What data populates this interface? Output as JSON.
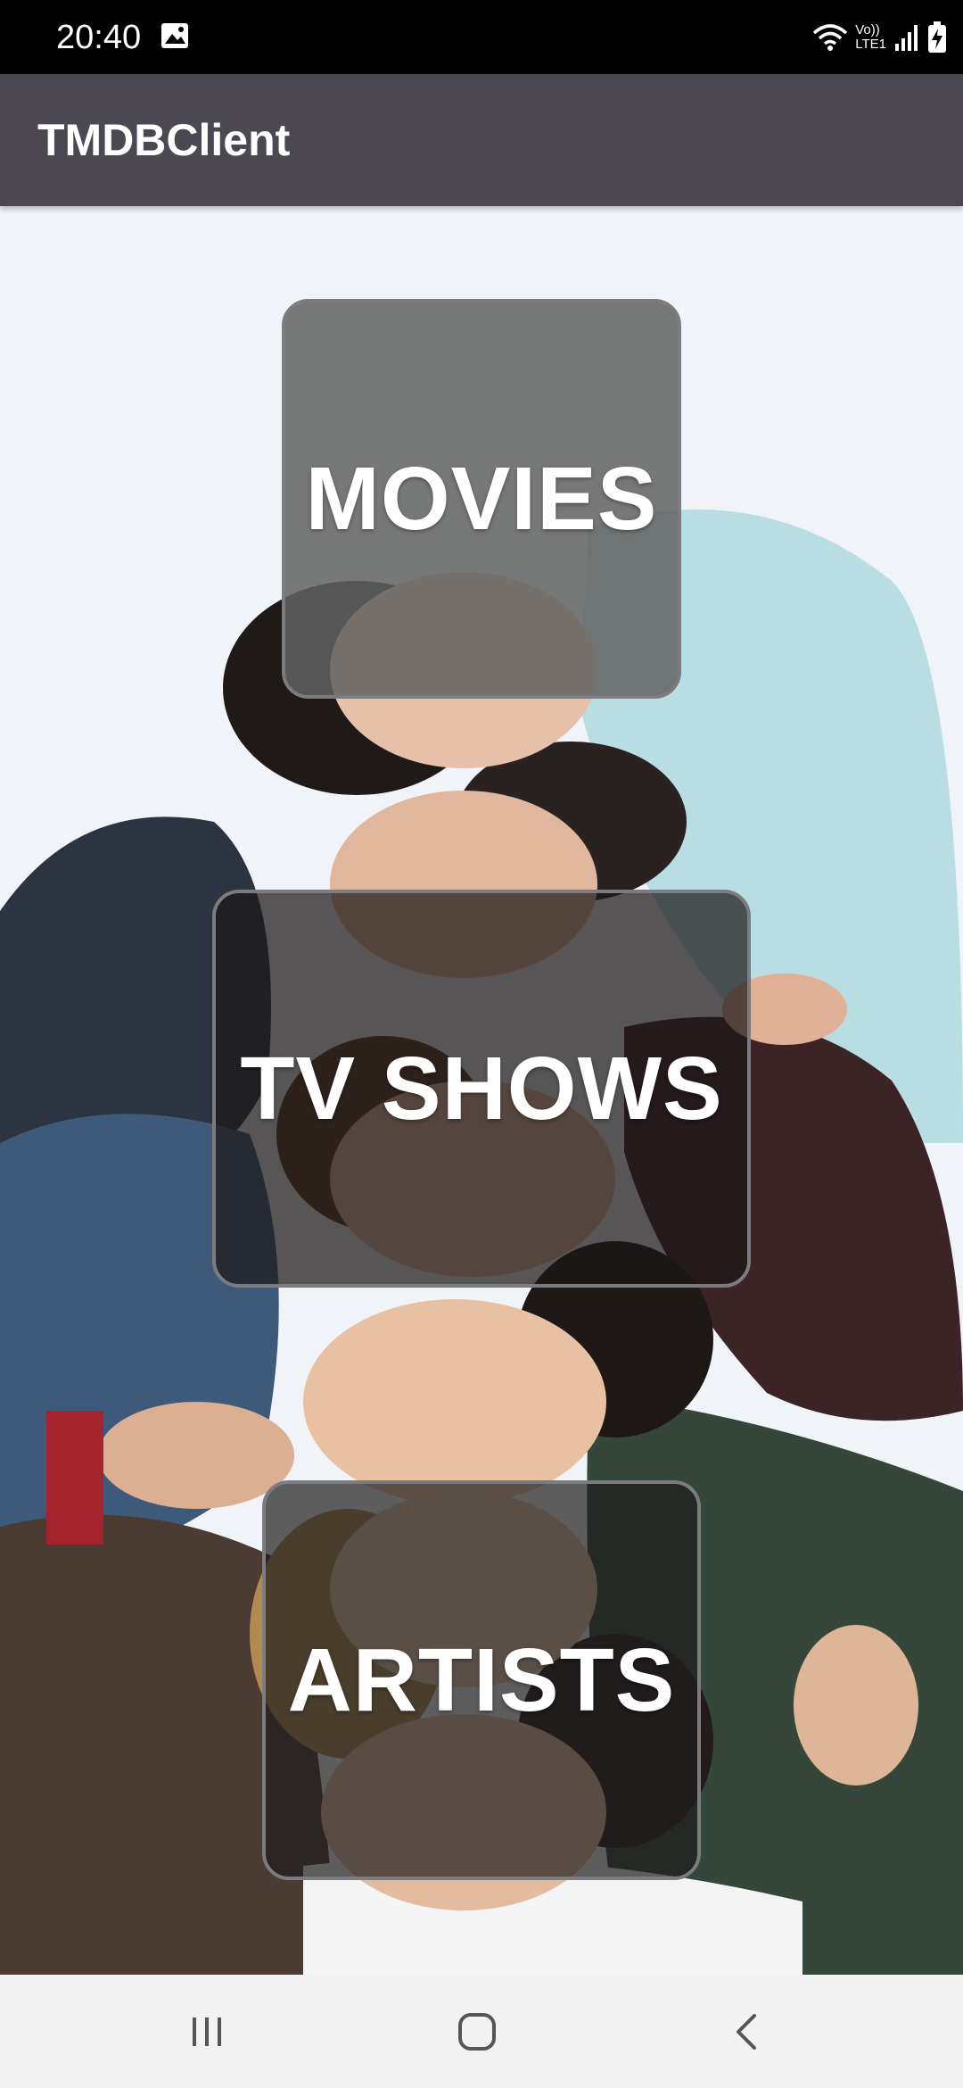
{
  "status_bar": {
    "time": "20:40",
    "network_label_top": "Vo))",
    "network_label_bottom": "LTE1",
    "icons": [
      "gallery-icon",
      "wifi-icon",
      "volte-lte-label",
      "signal-icon",
      "battery-charging-icon"
    ]
  },
  "app_bar": {
    "title": "TMDBClient",
    "background_color": "#4b4851"
  },
  "tiles": {
    "movies": {
      "label": "MOVIES"
    },
    "tv_shows": {
      "label": "TV SHOWS"
    },
    "artists": {
      "label": "ARTISTS"
    }
  },
  "nav_bar": {
    "buttons": [
      "recents-icon",
      "home-icon",
      "back-icon"
    ]
  }
}
